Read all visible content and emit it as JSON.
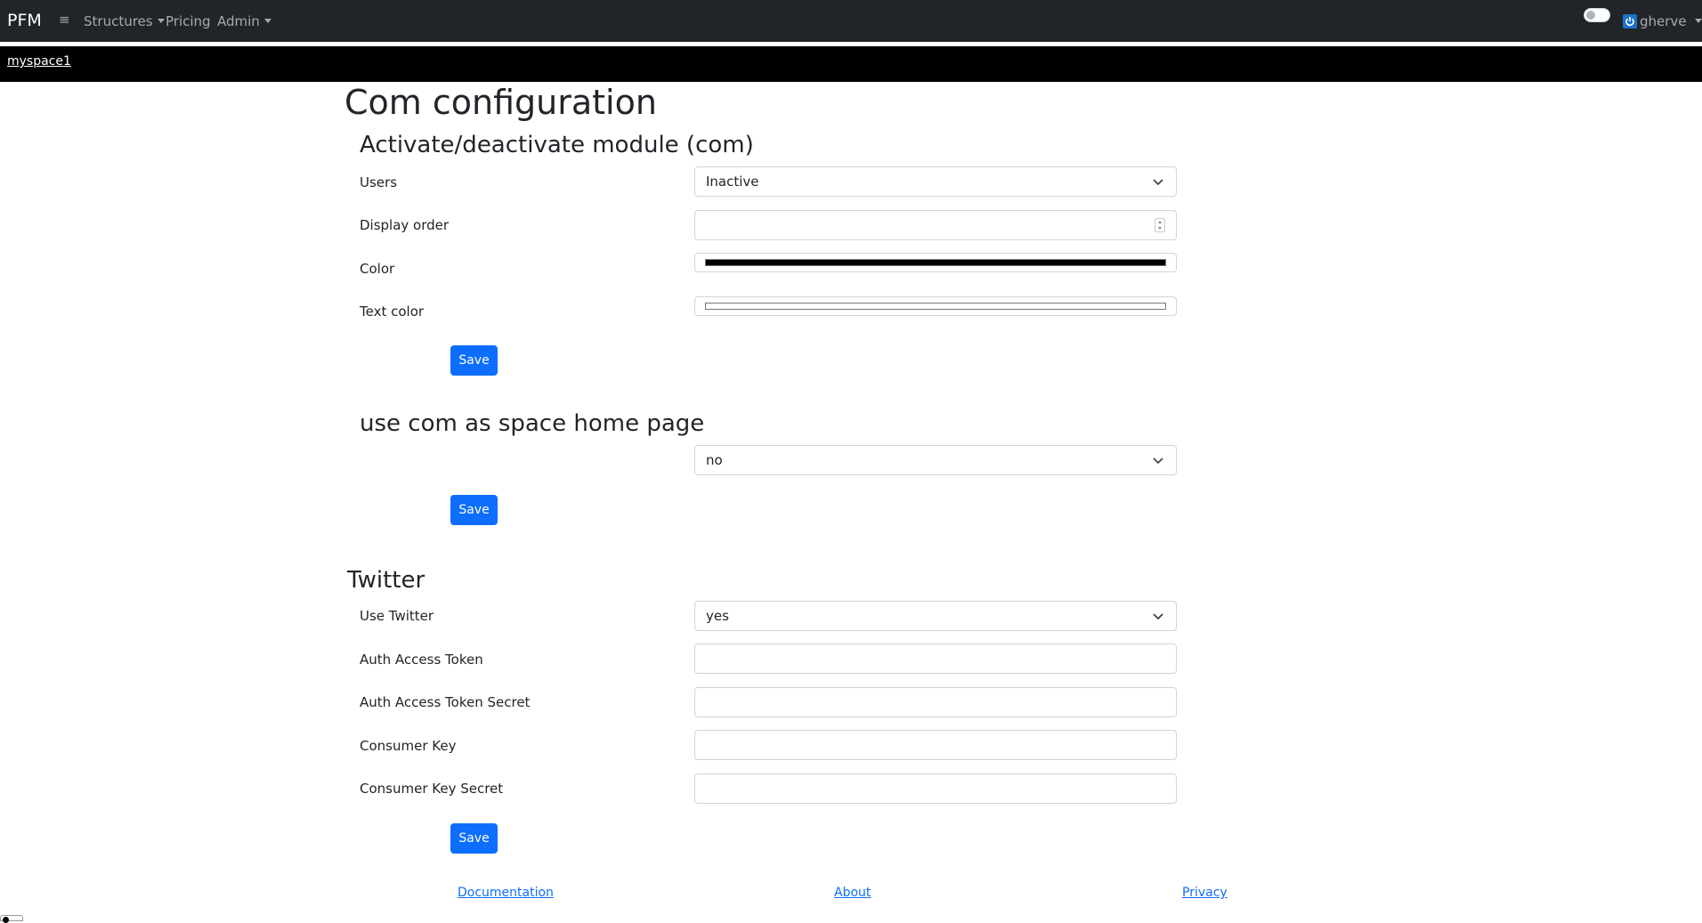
{
  "navbar": {
    "brand": "PFM",
    "menu_icon": "≡",
    "items": [
      {
        "label": "Structures",
        "dropdown": true
      },
      {
        "label": "Pricing",
        "dropdown": false
      },
      {
        "label": "Admin",
        "dropdown": true
      }
    ],
    "toggle_on": false,
    "user": {
      "name": "gherve",
      "icon": "power-icon",
      "icon_color": "#1a73c8"
    }
  },
  "space": {
    "name": "myspace1"
  },
  "page": {
    "title": "Com configuration"
  },
  "module_section": {
    "title": "Activate/deactivate module (com)",
    "users_label": "Users",
    "users_value": "Inactive",
    "display_order_label": "Display order",
    "display_order_value": "",
    "color_label": "Color",
    "color_value": "#000000",
    "text_color_label": "Text color",
    "text_color_value": "#ffffff",
    "save_label": "Save"
  },
  "home_section": {
    "title": "use com as space home page",
    "value": "no",
    "save_label": "Save"
  },
  "twitter_section": {
    "title": "Twitter",
    "use_twitter_label": "Use Twitter",
    "use_twitter_value": "yes",
    "auth_access_token_label": "Auth Access Token",
    "auth_access_token_value": "",
    "auth_access_token_secret_label": "Auth Access Token Secret",
    "auth_access_token_secret_value": "",
    "consumer_key_label": "Consumer Key",
    "consumer_key_value": "",
    "consumer_key_secret_label": "Consumer Key Secret",
    "consumer_key_secret_value": "",
    "save_label": "Save"
  },
  "footer": {
    "documentation": "Documentation",
    "about": "About",
    "privacy": "Privacy"
  },
  "colors": {
    "navbar_bg": "#212529",
    "spacebar_bg": "#000000",
    "primary": "#0d6efd"
  }
}
